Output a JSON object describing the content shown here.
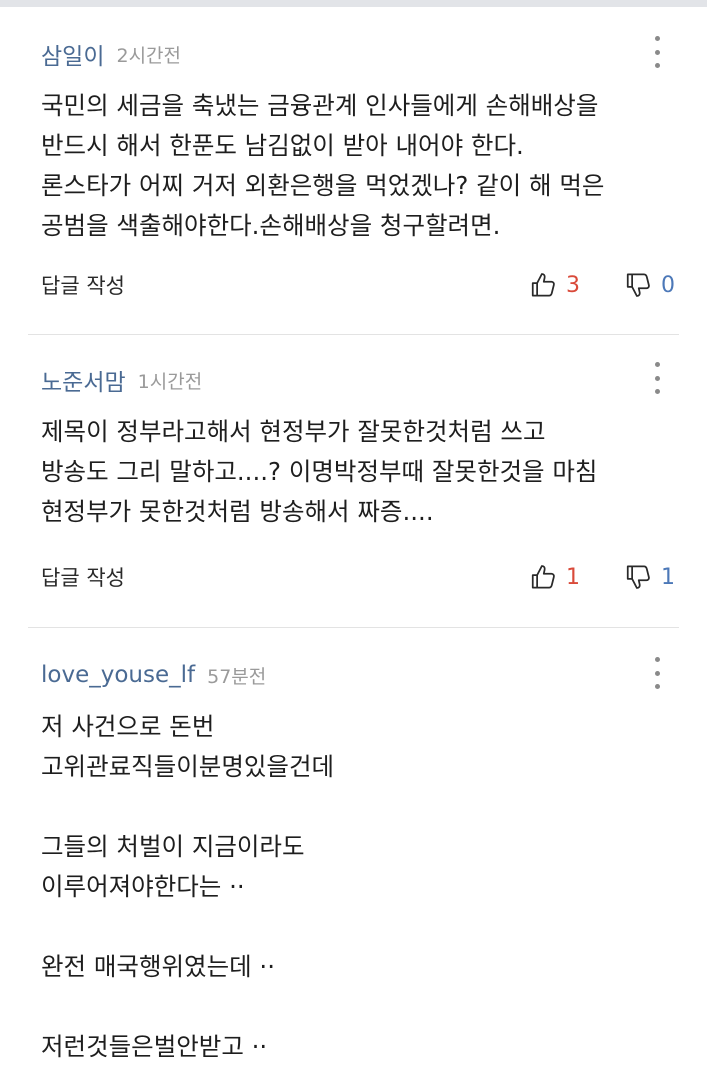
{
  "comments": [
    {
      "author": "삼일이",
      "time": "2시간전",
      "lines": [
        "국민의 세금을 축냈는 금융관계 인사들에게 손해배상을",
        "반드시 해서 한푼도 남김없이 받아 내어야 한다.",
        "론스타가 어찌 거저 외환은행을  먹었겠나? 같이 해 먹은",
        "공범을 색출해야한다.손해배상을 청구할려면."
      ],
      "reply_label": "답글 작성",
      "likes": "3",
      "dislikes": "0"
    },
    {
      "author": "노준서맘",
      "time": "1시간전",
      "lines": [
        "제목이 정부라고해서 현정부가 잘못한것처럼 쓰고",
        "방송도 그리 말하고....? 이명박정부때 잘못한것을  마침",
        "현정부가 못한것처럼 방송해서 짜증...."
      ],
      "reply_label": "답글 작성",
      "likes": "1",
      "dislikes": "1"
    },
    {
      "author": "love_youse_lf",
      "time": "57분전",
      "lines": [
        "저 사건으로 돈번",
        "고위관료직들이분명있을건데",
        "",
        "그들의 처벌이 지금이라도",
        "이루어져야한다는 ··",
        "",
        "완전 매국행위였는데 ··",
        "",
        "저런것들은벌안받고 ··"
      ]
    }
  ],
  "icons": {
    "more": "more-vertical-icon",
    "like": "thumbs-up-icon",
    "dislike": "thumbs-down-icon"
  },
  "colors": {
    "author": "#4a6a93",
    "like": "#d94a3a",
    "dislike": "#4c78b8"
  }
}
